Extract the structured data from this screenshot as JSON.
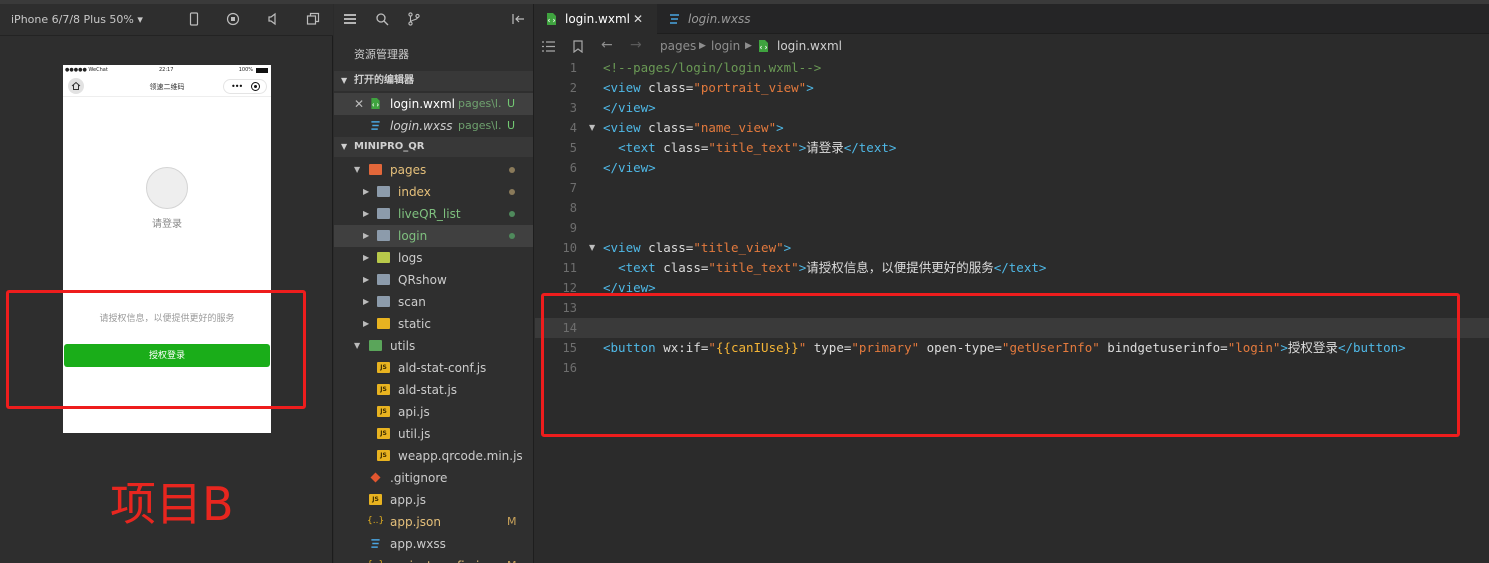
{
  "simulator": {
    "device": "iPhone 6/7/8 Plus 50% ▾",
    "status_left": "●●●●● WeChat",
    "status_time": "22:17",
    "status_right": "100%",
    "nav_title": "领速二维码",
    "capsule_more": "•••",
    "login_hint": "请登录",
    "auth_desc": "请授权信息，以便提供更好的服务",
    "auth_button": "授权登录",
    "project_label": "项目B"
  },
  "explorer": {
    "title": "资源管理器",
    "open_editors_header": "打开的编辑器",
    "project_header": "MINIPRO_QR",
    "open_editors": [
      {
        "name": "login.wxml",
        "path": "pages\\l...",
        "badge": "U"
      },
      {
        "name": "login.wxss",
        "path": "pages\\l...",
        "badge": "U"
      }
    ],
    "tree": {
      "pages": "pages",
      "index": "index",
      "liveQR_list": "liveQR_list",
      "login": "login",
      "logs": "logs",
      "QRshow": "QRshow",
      "scan": "scan",
      "static": "static",
      "utils": "utils",
      "ald_stat_conf": "ald-stat-conf.js",
      "ald_stat": "ald-stat.js",
      "api": "api.js",
      "util": "util.js",
      "qrcode": "weapp.qrcode.min.js",
      "gitignore": ".gitignore",
      "app_js": "app.js",
      "app_json": "app.json",
      "app_json_badge": "M",
      "app_wxss": "app.wxss",
      "project_config": "project.config.json",
      "project_config_badge": "M"
    },
    "js_icon": "JS",
    "json_icon": "{..}"
  },
  "editor": {
    "tabs": [
      {
        "label": "login.wxml",
        "close": "✕"
      },
      {
        "label": "login.wxss"
      }
    ],
    "breadcrumbs": [
      "pages",
      "login",
      "login.wxml"
    ],
    "lines": [
      {
        "n": "1",
        "parts": [
          [
            "c",
            "<!--pages/login/login.wxml-->"
          ]
        ]
      },
      {
        "n": "2",
        "parts": [
          [
            "tag",
            "<view "
          ],
          [
            "attr",
            "class="
          ],
          [
            "str",
            "\"portrait_view\""
          ],
          [
            "tag",
            ">"
          ]
        ]
      },
      {
        "n": "3",
        "parts": [
          [
            "tag",
            "</view>"
          ]
        ]
      },
      {
        "n": "4",
        "parts": [
          [
            "tag",
            "<view "
          ],
          [
            "attr",
            "class="
          ],
          [
            "str",
            "\"name_view\""
          ],
          [
            "tag",
            ">"
          ]
        ]
      },
      {
        "n": "5",
        "parts": [
          [
            "txt",
            "  "
          ],
          [
            "tag",
            "<text "
          ],
          [
            "attr",
            "class="
          ],
          [
            "str",
            "\"title_text\""
          ],
          [
            "tag",
            ">"
          ],
          [
            "txt",
            "请登录"
          ],
          [
            "tag",
            "</text>"
          ]
        ]
      },
      {
        "n": "6",
        "parts": [
          [
            "tag",
            "</view>"
          ]
        ]
      },
      {
        "n": "7",
        "parts": []
      },
      {
        "n": "8",
        "parts": []
      },
      {
        "n": "9",
        "parts": []
      },
      {
        "n": "10",
        "parts": [
          [
            "tag",
            "<view "
          ],
          [
            "attr",
            "class="
          ],
          [
            "str",
            "\"title_view\""
          ],
          [
            "tag",
            ">"
          ]
        ]
      },
      {
        "n": "11",
        "parts": [
          [
            "txt",
            "  "
          ],
          [
            "tag",
            "<text "
          ],
          [
            "attr",
            "class="
          ],
          [
            "str",
            "\"title_text\""
          ],
          [
            "tag",
            ">"
          ],
          [
            "txt",
            "请授权信息，以便提供更好的服务"
          ],
          [
            "tag",
            "</text>"
          ]
        ]
      },
      {
        "n": "12",
        "parts": [
          [
            "tag",
            "</view>"
          ]
        ]
      },
      {
        "n": "13",
        "parts": []
      },
      {
        "n": "14",
        "parts": []
      },
      {
        "n": "15",
        "parts": [
          [
            "tag",
            "<button "
          ],
          [
            "attr",
            "wx:if="
          ],
          [
            "str",
            "\""
          ],
          [
            "bind",
            "{{canIUse}}"
          ],
          [
            "str",
            "\""
          ],
          [
            "attr",
            " type="
          ],
          [
            "str",
            "\"primary\""
          ],
          [
            "attr",
            " open-type="
          ],
          [
            "str",
            "\"getUserInfo\""
          ],
          [
            "attr",
            " bindgetuserinfo="
          ],
          [
            "str",
            "\"login\""
          ],
          [
            "tag",
            ">"
          ],
          [
            "txt",
            "授权登录"
          ],
          [
            "tag",
            "</button>"
          ]
        ]
      },
      {
        "n": "16",
        "parts": []
      }
    ]
  },
  "colors": {
    "annotation_red": "#ee1d1d",
    "wechat_green": "#1aad19"
  }
}
